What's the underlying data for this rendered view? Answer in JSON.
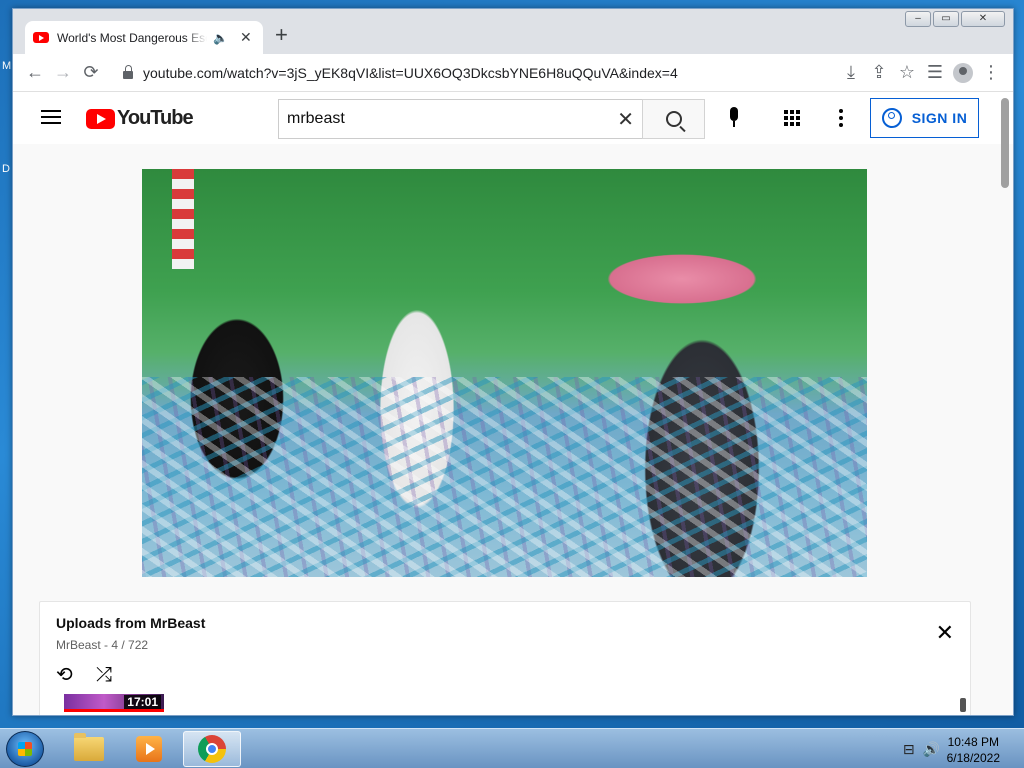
{
  "desktop": {
    "edge_letters": [
      "M",
      "D"
    ]
  },
  "browser": {
    "tab": {
      "title": "World's Most Dangerous Esc",
      "audio_icon": "speaker-icon",
      "close": "✕"
    },
    "new_tab": "+",
    "window_controls": [
      "–",
      "▭",
      "✕"
    ],
    "url": "youtube.com/watch?v=3jS_yEK8qVI&list=UUX6OQ3DkcsbYNE6H8uQQuVA&index=4",
    "nav": {
      "back": "←",
      "forward": "→",
      "reload": "⟳"
    },
    "actions": {
      "install": "⤓",
      "share": "⇪",
      "bookmark": "☆",
      "reading_list": "☰",
      "menu": "⋮"
    }
  },
  "youtube": {
    "logo_text": "YouTube",
    "search": {
      "value": "mrbeast",
      "clear": "✕"
    },
    "sign_in": "SIGN IN"
  },
  "playlist": {
    "title": "Uploads from MrBeast",
    "channel": "MrBeast",
    "position": "4 / 722",
    "close": "✕",
    "loop": "⟲",
    "shuffle": "⤮",
    "thumb_duration": "17:01"
  },
  "taskbar": {
    "time": "10:48 PM",
    "date": "6/18/2022",
    "tray": {
      "network": "⊟",
      "volume": "🔊"
    }
  },
  "colors": {
    "youtube_red": "#ff0000",
    "link_blue": "#065fd4"
  }
}
